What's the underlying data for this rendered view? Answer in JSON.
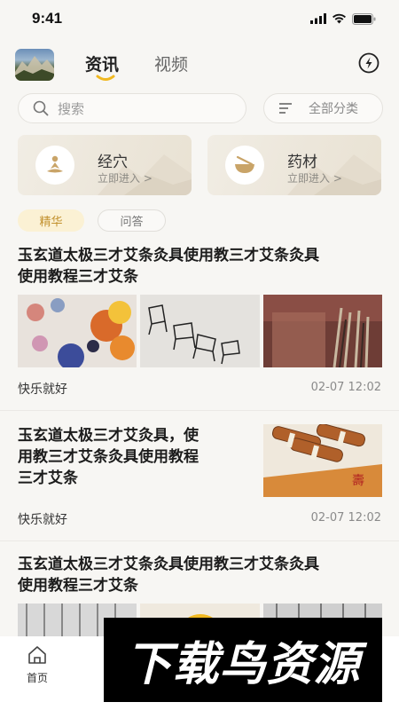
{
  "status_bar": {
    "time": "9:41"
  },
  "header": {
    "tabs": [
      {
        "label": "资讯",
        "active": true
      },
      {
        "label": "视频",
        "active": false
      }
    ]
  },
  "search": {
    "placeholder": "搜索"
  },
  "category_button": {
    "label": "全部分类"
  },
  "entry_cards": [
    {
      "title": "经穴",
      "subtitle": "立即进入 >",
      "icon": "meditation-icon"
    },
    {
      "title": "药材",
      "subtitle": "立即进入 >",
      "icon": "herb-bowl-icon"
    }
  ],
  "filter_chips": [
    {
      "label": "精华",
      "active": true
    },
    {
      "label": "问答",
      "active": false
    }
  ],
  "articles": [
    {
      "title_line1": "玉玄道太极三才艾条灸具使用教三才艾条灸具",
      "title_line2": "使用教程三才艾条",
      "author": "快乐就好",
      "time": "02-07 12:02",
      "images": [
        "paint-palette-image",
        "chairs-image",
        "brushes-image"
      ]
    },
    {
      "title_line1": "玉玄道太极三才艾灸具，使",
      "title_line2": "用教三才艾条灸具使用教程",
      "title_line3": "三才艾条",
      "author": "快乐就好",
      "time": "02-07 12:02",
      "images": [
        "cinnamon-herbs-image"
      ]
    },
    {
      "title_line1": "玉玄道太极三才艾条灸具使用教三才艾条灸具",
      "title_line2": "使用教程三才艾条"
    }
  ],
  "bottom_nav": {
    "home_label": "首页"
  },
  "watermark": {
    "text": "下载鸟资源"
  },
  "colors": {
    "accent_gold": "#f0b820",
    "chip_active_bg": "#fbf1d4",
    "chip_active_text": "#c2912e"
  }
}
